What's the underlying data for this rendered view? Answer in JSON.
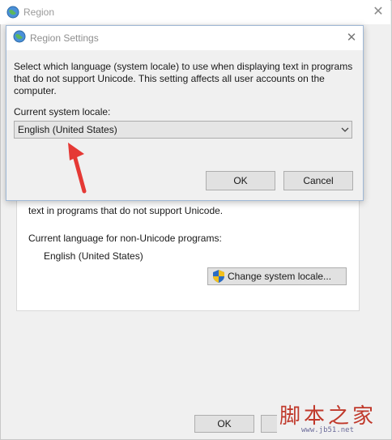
{
  "background_window": {
    "title": "Region",
    "description": "text in programs that do not support Unicode.",
    "current_language_label": "Current language for non-Unicode programs:",
    "current_language_value": "English (United States)",
    "change_button_label": "Change system locale...",
    "ok_label": "OK"
  },
  "dialog": {
    "title": "Region Settings",
    "description": "Select which language (system locale) to use when displaying text in programs that do not support Unicode. This setting affects all user accounts on the computer.",
    "locale_label": "Current system locale:",
    "locale_value": "English (United States)",
    "ok_label": "OK",
    "cancel_label": "Cancel"
  },
  "annotation": {
    "color": "#e53935",
    "type": "arrow pointing to locale dropdown"
  },
  "watermark": {
    "text": "脚本之家",
    "url": "www.jb51.net"
  },
  "icons": {
    "window_icon": "globe-icon",
    "dialog_icon": "globe-icon",
    "shield": "uac-shield-icon",
    "close": "close-icon",
    "dropdown": "chevron-down-icon"
  }
}
